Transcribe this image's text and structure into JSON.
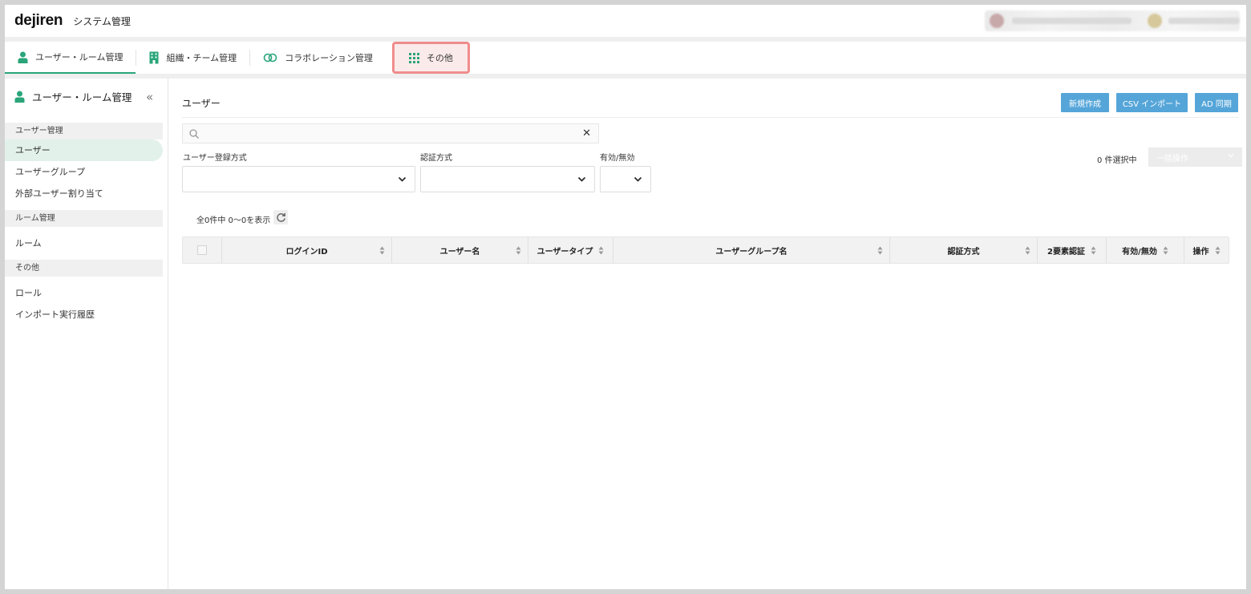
{
  "header": {
    "logo": "dejiren",
    "app_title": "システム管理"
  },
  "tabs": [
    {
      "label": "ユーザー・ルーム管理",
      "icon": "person-icon",
      "active": true
    },
    {
      "label": "組織・チーム管理",
      "icon": "building-icon"
    },
    {
      "label": "コラボレーション管理",
      "icon": "link-icon"
    },
    {
      "label": "その他",
      "icon": "grid-dots-icon",
      "highlighted": true
    }
  ],
  "sidebar": {
    "title": "ユーザー・ルーム管理",
    "collapse_glyph": "«",
    "groups": [
      {
        "label": "ユーザー管理",
        "items": [
          "ユーザー",
          "ユーザーグループ",
          "外部ユーザー割り当て"
        ]
      },
      {
        "label": "ルーム管理",
        "items": [
          "ルーム"
        ]
      },
      {
        "label": "その他",
        "items": [
          "ロール",
          "インポート実行履歴"
        ]
      }
    ]
  },
  "main": {
    "title": "ユーザー",
    "buttons": {
      "create": "新規作成",
      "csv_import": "CSV インポート",
      "ad_sync": "AD 同期"
    },
    "search": {
      "value": "",
      "placeholder": "",
      "clear_glyph": "✕"
    },
    "filters": {
      "registration_label": "ユーザー登録方式",
      "auth_label": "認証方式",
      "status_label": "有効/無効"
    },
    "selection_count": "0 件選択中",
    "bulk_action": "一括操作",
    "result_count": "全0件中 0～0を表示",
    "table_headers": [
      "ログインID",
      "ユーザー名",
      "ユーザータイプ",
      "ユーザーグループ名",
      "認証方式",
      "2要素認証",
      "有効/無効",
      "操作"
    ]
  },
  "colors": {
    "accent_green": "#2aa57a",
    "button_blue": "#55a5d9",
    "highlight_border": "#f08c8c",
    "active_sidebar_bg": "#e2f1ea"
  }
}
